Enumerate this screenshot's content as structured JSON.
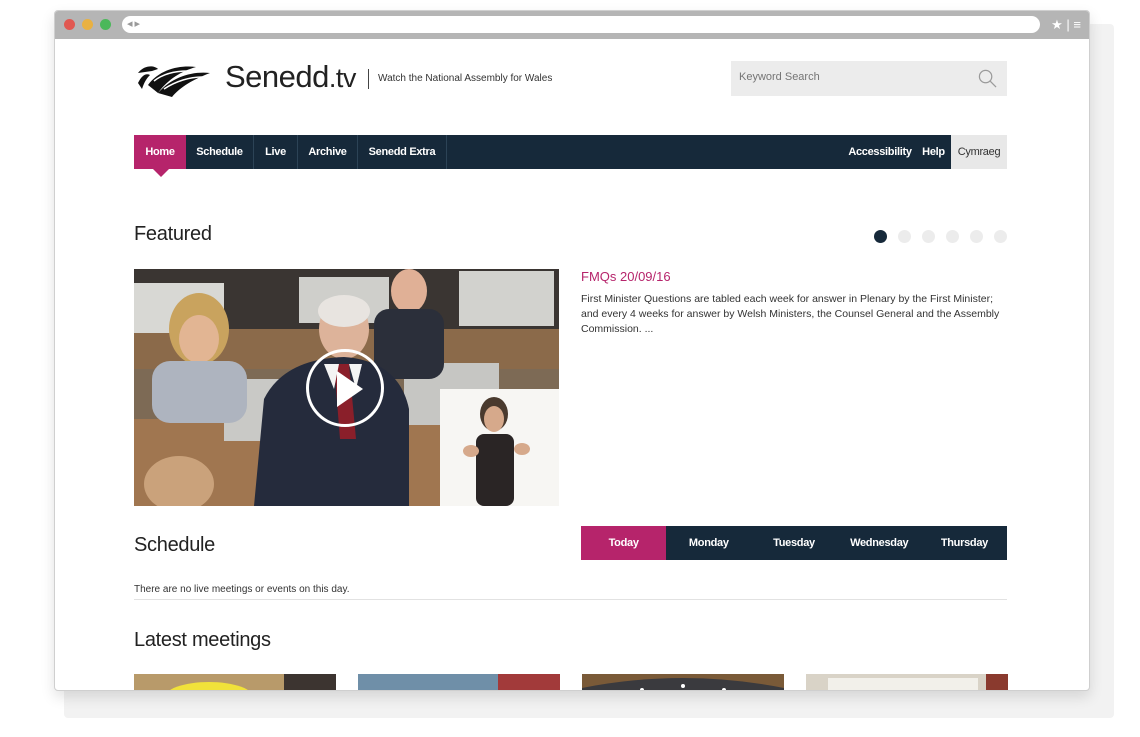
{
  "site": {
    "brand_main": "Senedd",
    "brand_tv": ".tv",
    "tagline": "Watch the National Assembly for Wales",
    "search_placeholder": "Keyword Search"
  },
  "nav": {
    "items": [
      "Home",
      "Schedule",
      "Live",
      "Archive",
      "Senedd Extra"
    ],
    "right": [
      "Accessibility",
      "Help"
    ],
    "language": "Cymraeg"
  },
  "featured": {
    "heading": "Featured",
    "carousel_pages": 6,
    "active_page": 1,
    "item_title": "FMQs 20/09/16",
    "item_description": "First Minister Questions are tabled each week for answer in Plenary by the First Minister; and every 4 weeks for answer by Welsh Ministers, the Counsel General and the Assembly Commission. ..."
  },
  "schedule": {
    "heading": "Schedule",
    "tabs": [
      "Today",
      "Monday",
      "Tuesday",
      "Wednesday",
      "Thursday"
    ],
    "active_tab": "Today",
    "empty_message": "There are no live meetings or events on this day."
  },
  "latest": {
    "heading": "Latest meetings"
  },
  "colors": {
    "accent": "#b6246b",
    "navy": "#16293a"
  }
}
